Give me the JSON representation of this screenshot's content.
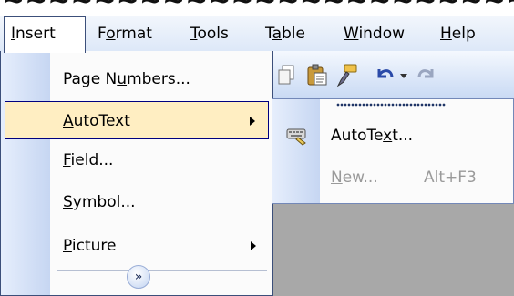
{
  "menubar": {
    "items": [
      {
        "pre": "",
        "ul": "I",
        "post": "nsert"
      },
      {
        "pre": "F",
        "ul": "o",
        "post": "rmat"
      },
      {
        "pre": "",
        "ul": "T",
        "post": "ools"
      },
      {
        "pre": "T",
        "ul": "a",
        "post": "ble"
      },
      {
        "pre": "",
        "ul": "W",
        "post": "indow"
      },
      {
        "pre": "",
        "ul": "H",
        "post": "elp"
      }
    ]
  },
  "insert_menu": {
    "items": [
      {
        "pre": "Page N",
        "ul": "u",
        "post": "mbers..."
      },
      {
        "pre": "",
        "ul": "A",
        "post": "utoText"
      },
      {
        "pre": "",
        "ul": "F",
        "post": "ield..."
      },
      {
        "pre": "",
        "ul": "S",
        "post": "ymbol..."
      },
      {
        "pre": "",
        "ul": "P",
        "post": "icture"
      }
    ],
    "expand_glyph": "»"
  },
  "autotext_submenu": {
    "items": [
      {
        "pre": "AutoTe",
        "ul": "x",
        "post": "t...",
        "shortcut": "",
        "enabled": true
      },
      {
        "pre": "",
        "ul": "N",
        "post": "ew...",
        "shortcut": "Alt+F3",
        "enabled": false
      }
    ]
  },
  "colors": {
    "highlight": "#ffeec2",
    "menu_border": "#3c4f7a",
    "icon_strip": "#c6d6f2"
  }
}
